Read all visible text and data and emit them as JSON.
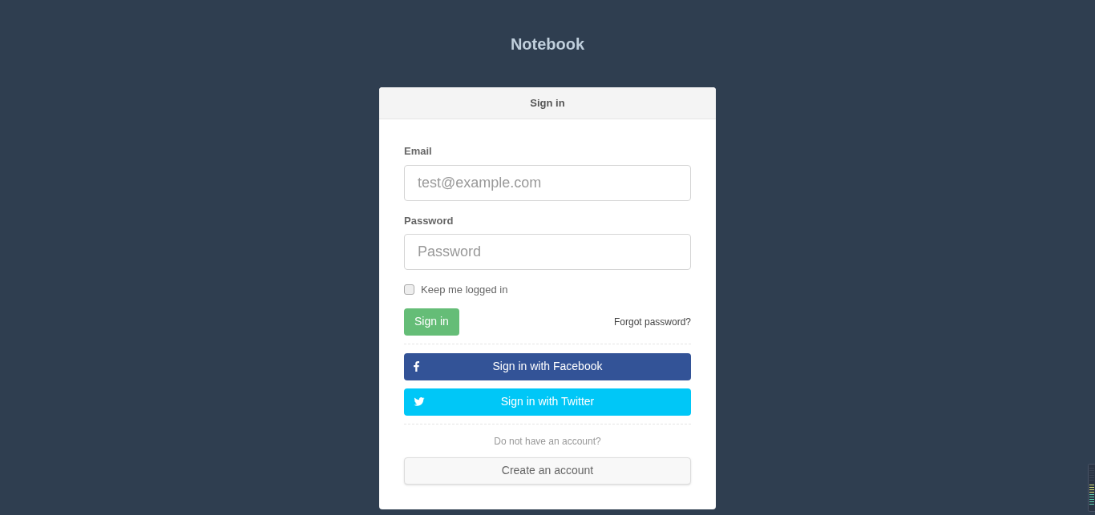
{
  "app_title": "Notebook",
  "panel": {
    "title": "Sign in"
  },
  "fields": [
    {
      "label": "Email",
      "placeholder": "test@example.com"
    },
    {
      "label": "Password",
      "placeholder": "Password"
    }
  ],
  "remember": {
    "label": "Keep me logged in",
    "checked": false
  },
  "submit": "Sign in",
  "forgot_link": "Forgot password?",
  "social": [
    {
      "kind": "facebook",
      "label": "Sign in with Facebook",
      "color": "#335397"
    },
    {
      "kind": "twitter",
      "label": "Sign in with Twitter",
      "color": "#00c7f7"
    }
  ],
  "signup_prompt": "Do not have an account?",
  "signup_button": "Create an account"
}
